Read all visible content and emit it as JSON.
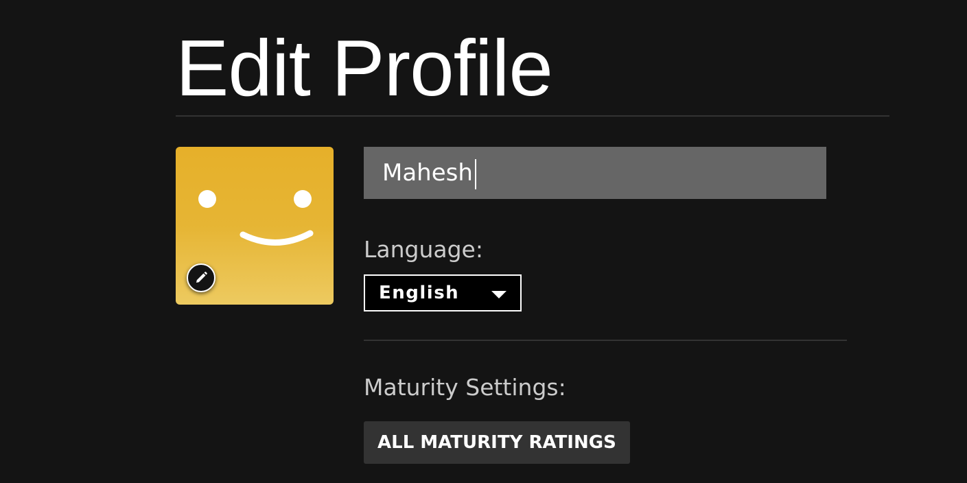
{
  "page": {
    "title": "Edit Profile"
  },
  "profile": {
    "avatar_icon": "smiley-face-icon",
    "avatar_color": "#e6b42e",
    "edit_icon": "pencil-icon",
    "name_value": "Mahesh"
  },
  "language": {
    "label": "Language:",
    "selected": "English",
    "arrow_icon": "caret-down-icon"
  },
  "maturity": {
    "label": "Maturity Settings:",
    "button_label": "ALL MATURITY RATINGS"
  },
  "colors": {
    "background": "#141414",
    "input_bg": "#666666",
    "button_bg": "#333333",
    "text": "#ffffff",
    "label_text": "#cccccc"
  }
}
